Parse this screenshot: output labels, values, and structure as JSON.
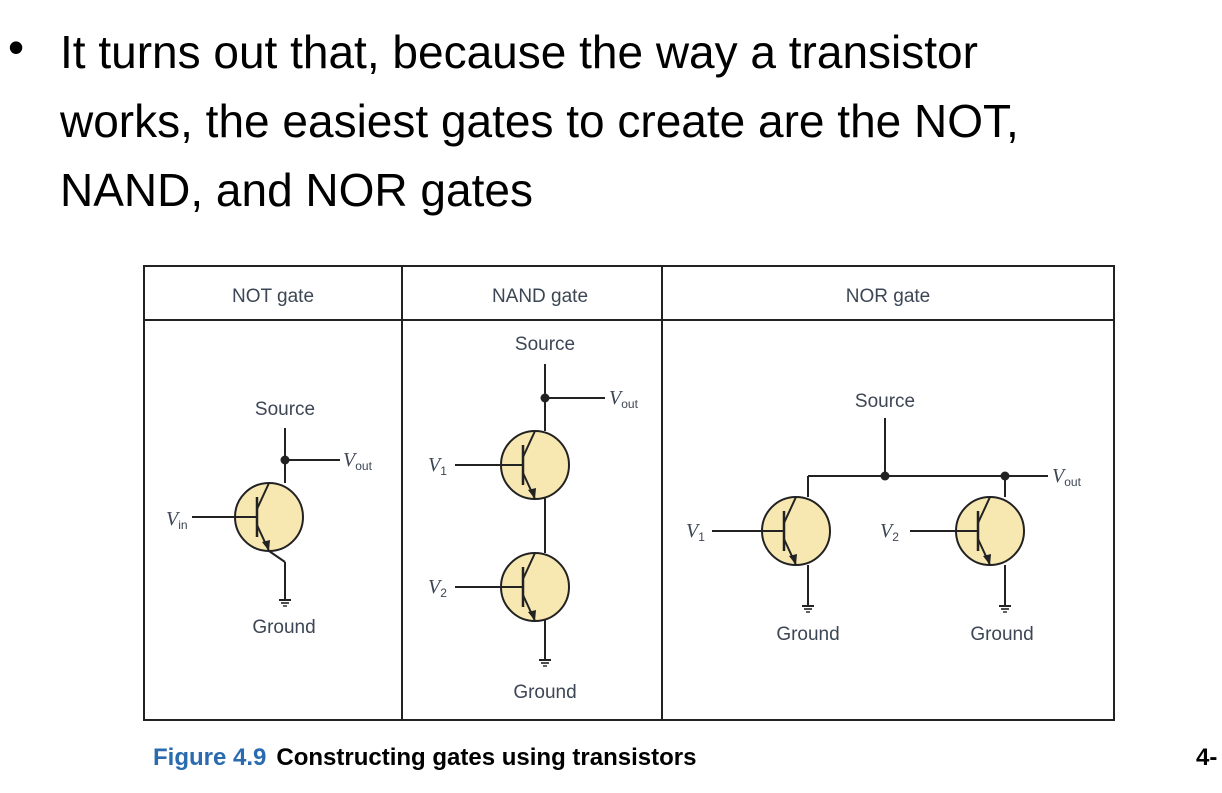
{
  "slide": {
    "bullet_lines": [
      "It turns out that, because the way a transistor",
      "works, the easiest gates to create are the NOT,",
      "NAND, and NOR gates"
    ]
  },
  "figure": {
    "columns": [
      "NOT gate",
      "NAND gate",
      "NOR gate"
    ],
    "not_gate": {
      "source": "Source",
      "ground": "Ground",
      "vin": "V",
      "vin_sub": "in",
      "vout": "V",
      "vout_sub": "out"
    },
    "nand_gate": {
      "source": "Source",
      "ground": "Ground",
      "v1": "V",
      "v1_sub": "1",
      "v2": "V",
      "v2_sub": "2",
      "vout": "V",
      "vout_sub": "out"
    },
    "nor_gate": {
      "source": "Source",
      "ground_left": "Ground",
      "ground_right": "Ground",
      "v1": "V",
      "v1_sub": "1",
      "v2": "V",
      "v2_sub": "2",
      "vout": "V",
      "vout_sub": "out"
    },
    "colors": {
      "transistor_fill": "#f7e8b2",
      "stroke": "#222222",
      "label": "#3c4654"
    }
  },
  "caption": {
    "figure_number": "Figure 4.9",
    "text": "Constructing gates using transistors"
  },
  "page_number": "4-"
}
